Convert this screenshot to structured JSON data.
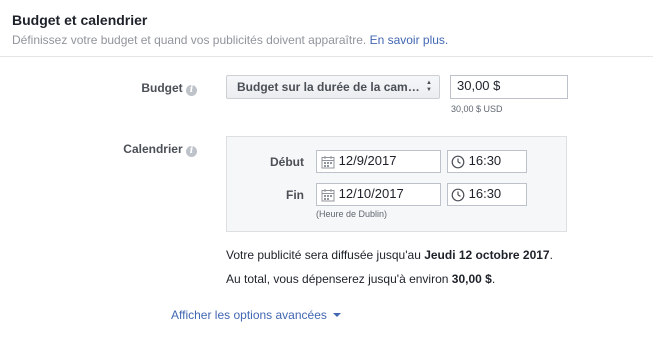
{
  "section": {
    "title": "Budget et calendrier",
    "subtitle": "Définissez votre budget et quand vos publicités doivent apparaître.",
    "learn_more": "En savoir plus."
  },
  "budget": {
    "label": "Budget",
    "type_selected": "Budget sur la durée de la cam…",
    "amount_value": "30,00 $",
    "amount_note": "30,00 $ USD"
  },
  "schedule": {
    "label": "Calendrier",
    "start_label": "Début",
    "start_date": "12/9/2017",
    "start_time": "16:30",
    "end_label": "Fin",
    "end_date": "12/10/2017",
    "end_time": "16:30",
    "timezone_note": "(Heure de Dublin)"
  },
  "summary": {
    "line1_prefix": "Votre publicité sera diffusée jusqu'au ",
    "line1_date": "Jeudi 12 octobre 2017",
    "line1_suffix": ".",
    "line2_prefix": "Au total, vous dépenserez jusqu'à environ ",
    "line2_amount": "30,00 $",
    "line2_suffix": "."
  },
  "advanced": {
    "label": "Afficher les options avancées"
  },
  "colors": {
    "link": "#4267b2",
    "muted": "#90949c",
    "box_bg": "#f6f7f9"
  },
  "icons": [
    "help-icon",
    "calendar-icon",
    "clock-icon",
    "chevron-down-icon",
    "select-caret-icon"
  ]
}
